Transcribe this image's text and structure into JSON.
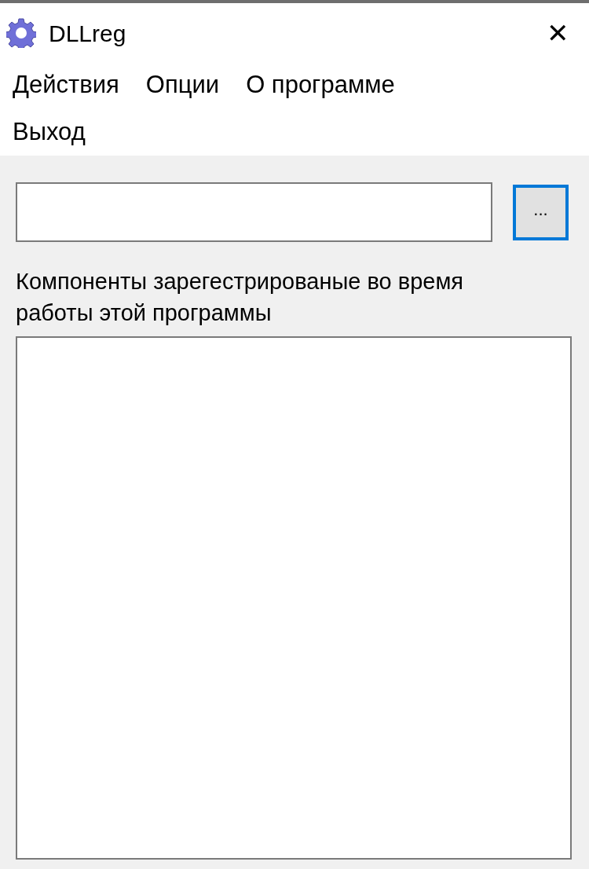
{
  "window": {
    "title": "DLLreg",
    "close": "✕"
  },
  "menu": [
    {
      "label": "Действия"
    },
    {
      "label": "Опции"
    },
    {
      "label": "О программе"
    },
    {
      "label": "Выход"
    }
  ],
  "browse_button": {
    "label": "...",
    "focused": true
  },
  "list_label": "Компоненты зарегестрированые во время работы этой программы"
}
